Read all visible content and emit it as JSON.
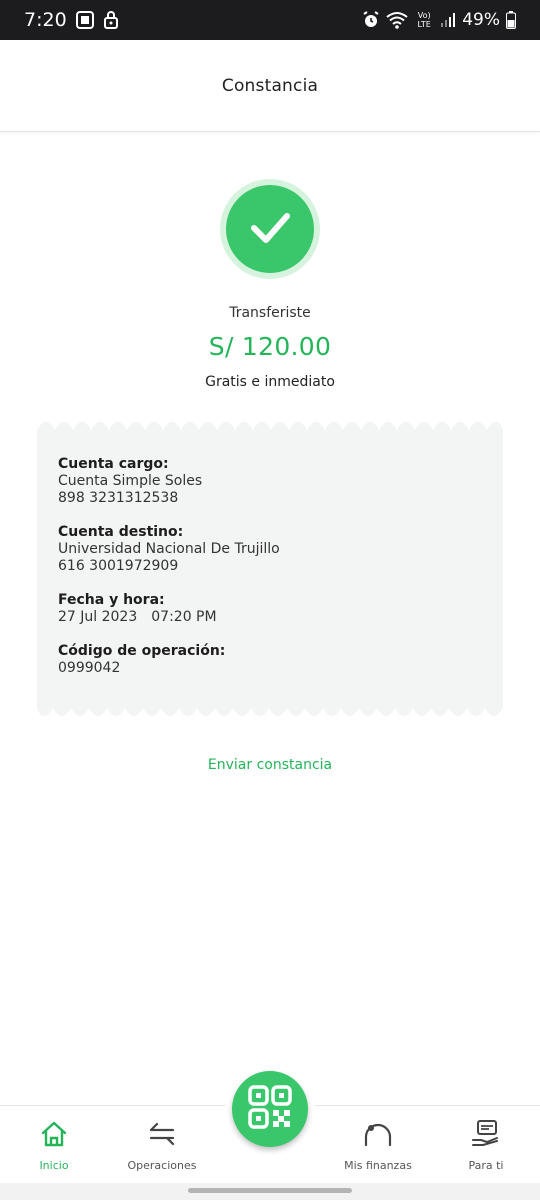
{
  "status_bar": {
    "time": "7:20",
    "network_label": "Vo) LTE",
    "battery": "49%",
    "icons": [
      "screen-record-icon",
      "lock-icon",
      "alarm-icon",
      "wifi-icon",
      "signal-icon",
      "battery-icon"
    ]
  },
  "header": {
    "title": "Constancia"
  },
  "success": {
    "icon": "checkmark-icon",
    "label": "Transferiste",
    "amount": "S/ 120.00",
    "note": "Gratis e inmediato"
  },
  "receipt": {
    "fields": [
      {
        "label": "Cuenta cargo:",
        "lines": [
          "Cuenta Simple Soles",
          "898 3231312538"
        ]
      },
      {
        "label": "Cuenta destino:",
        "lines": [
          "Universidad Nacional De Trujillo",
          "616 3001972909"
        ]
      },
      {
        "label": "Fecha y hora:",
        "date": "27 Jul 2023",
        "time": "07:20 PM"
      },
      {
        "label": "Código de operación:",
        "lines": [
          "0999042"
        ]
      }
    ]
  },
  "actions": {
    "send_receipt": "Enviar constancia"
  },
  "bottom_nav": {
    "items": [
      {
        "label": "Inicio",
        "icon": "home-icon",
        "active": true
      },
      {
        "label": "Operaciones",
        "icon": "transfer-arrows-icon",
        "active": false
      },
      {
        "label": "Mis finanzas",
        "icon": "finance-gauge-icon",
        "active": false
      },
      {
        "label": "Para ti",
        "icon": "hand-card-icon",
        "active": false
      }
    ],
    "center": {
      "icon": "qr-code-icon"
    }
  },
  "colors": {
    "accent": "#25b559",
    "success_circle": "#3ac66a",
    "success_ring": "#d6f3de",
    "receipt_bg": "#f3f4f4",
    "status_bar_bg": "#1c1c1e"
  }
}
